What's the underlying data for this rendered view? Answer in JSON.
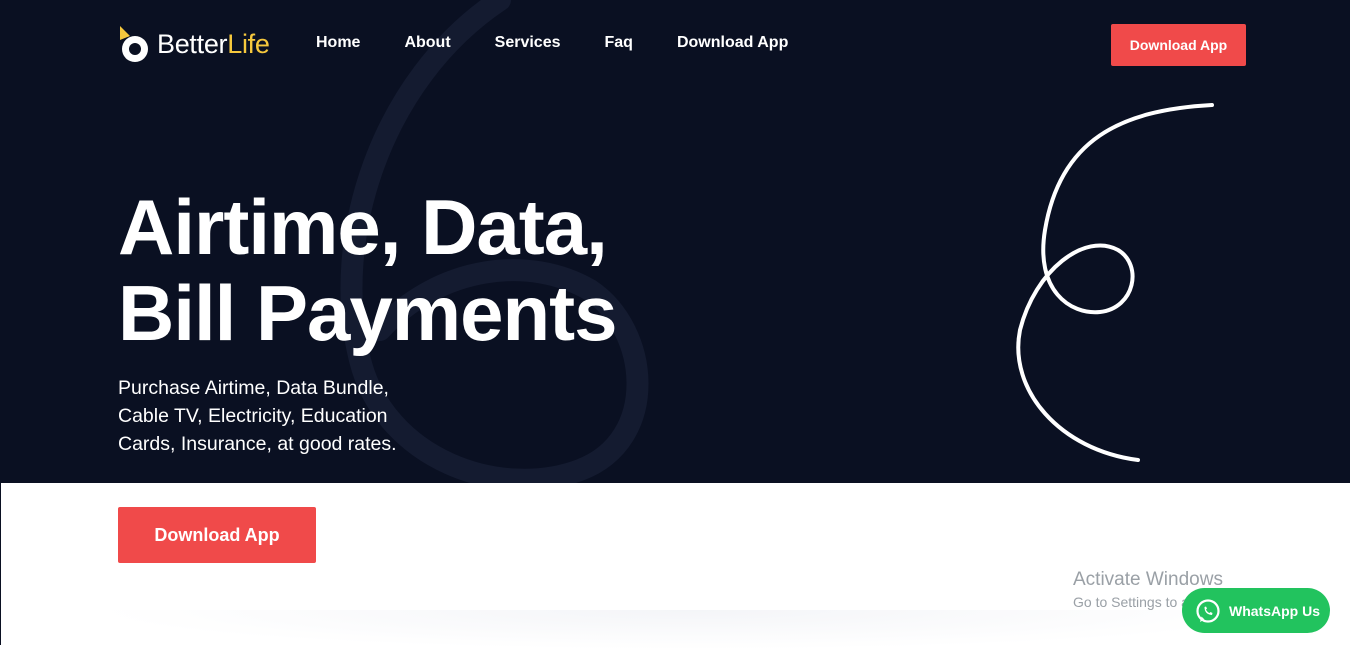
{
  "brand": {
    "name_part1": "Better",
    "name_part2": "Life",
    "accent_color": "#f6c83d"
  },
  "nav": {
    "items": [
      "Home",
      "About",
      "Services",
      "Faq",
      "Download App"
    ]
  },
  "header_button": "Download App",
  "hero": {
    "headline_line1": "Airtime, Data,",
    "headline_line2": "Bill Payments",
    "subtext": "Purchase Airtime, Data Bundle, Cable TV, Electricity, Education Cards, Insurance, at good rates.",
    "cta_label": "Download App",
    "background_color": "#0a1022",
    "cta_color": "#f04a4a"
  },
  "watermark": {
    "line1": "Activate Windows",
    "line2": "Go to Settings to activate Windows."
  },
  "whatsapp": {
    "label": "WhatsApp Us",
    "icon": "whatsapp-icon",
    "color": "#22c35e"
  }
}
